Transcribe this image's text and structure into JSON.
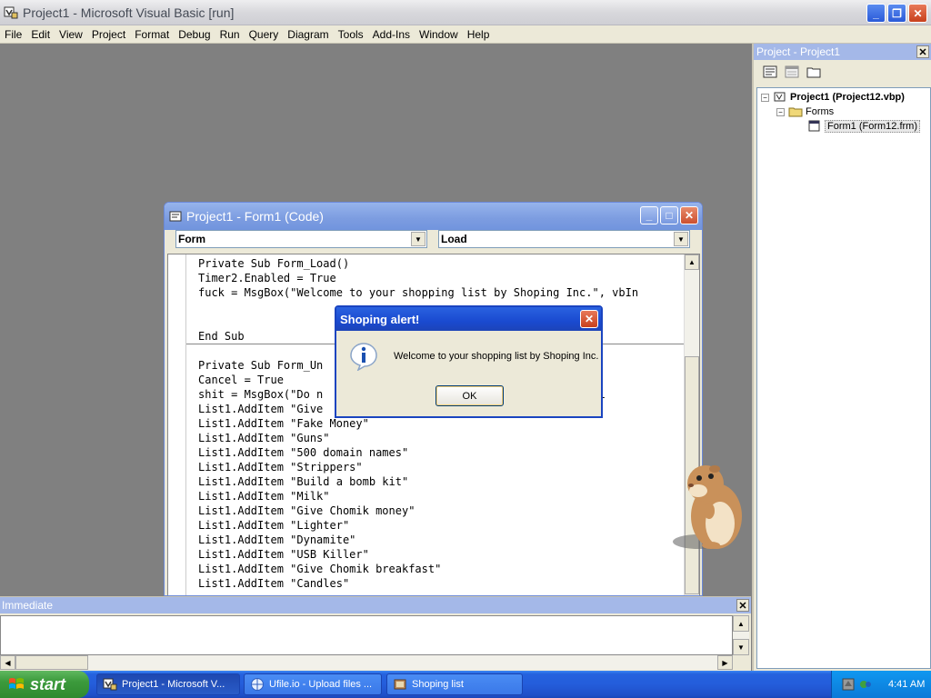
{
  "window": {
    "title": "Project1 - Microsoft Visual Basic [run]"
  },
  "menu": [
    "File",
    "Edit",
    "View",
    "Project",
    "Format",
    "Debug",
    "Run",
    "Query",
    "Diagram",
    "Tools",
    "Add-Ins",
    "Window",
    "Help"
  ],
  "project_explorer": {
    "title": "Project - Project1",
    "tree": {
      "project": "Project1 (Project12.vbp)",
      "folder": "Forms",
      "form": "Form1 (Form12.frm)"
    }
  },
  "code_window": {
    "title": "Project1 - Form1 (Code)",
    "object_combo": "Form",
    "proc_combo": "Load",
    "lines": [
      "Private Sub Form_Load()",
      "Timer2.Enabled = True",
      "fuck = MsgBox(\"Welcome to your shopping list by Shoping Inc.\", vbIn",
      "",
      "",
      "End Sub",
      "",
      "Private Sub Form_Un",
      "Cancel = True",
      "shit = MsgBox(\"Do n                                ent you wil",
      "List1.AddItem \"Give",
      "List1.AddItem \"Fake Money\"",
      "List1.AddItem \"Guns\"",
      "List1.AddItem \"500 domain names\"",
      "List1.AddItem \"Strippers\"",
      "List1.AddItem \"Build a bomb kit\"",
      "List1.AddItem \"Milk\"",
      "List1.AddItem \"Give Chomik money\"",
      "List1.AddItem \"Lighter\"",
      "List1.AddItem \"Dynamite\"",
      "List1.AddItem \"USB Killer\"",
      "List1.AddItem \"Give Chomik breakfast\"",
      "List1.AddItem \"Candles\""
    ]
  },
  "dialog": {
    "title": "Shoping alert!",
    "message": "Welcome to your shopping list by Shoping Inc.",
    "ok": "OK"
  },
  "immediate": {
    "title": "Immediate"
  },
  "taskbar": {
    "start": "start",
    "tasks": [
      "Project1 - Microsoft V...",
      "Ufile.io - Upload files ...",
      "Shoping list"
    ],
    "clock": "4:41 AM"
  },
  "colors": {
    "dialog_title": "#1a4ad0",
    "code_title": "#7c9ce0",
    "taskbar": "#245ddb",
    "start": "#3c9a3c"
  },
  "icons": [
    "vb-app-icon",
    "project-icon",
    "folder-icon",
    "form-icon",
    "info-icon",
    "windows-flag-icon"
  ]
}
